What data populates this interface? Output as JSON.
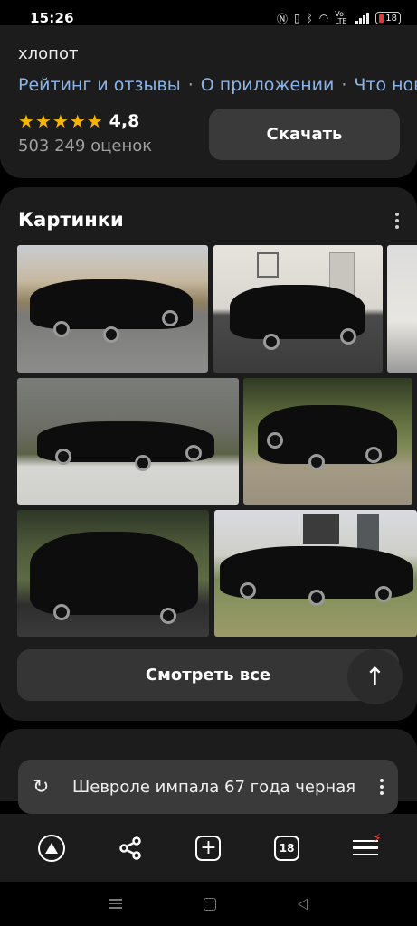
{
  "status_bar": {
    "time": "15:26",
    "battery": "18",
    "network": "Vo LTE"
  },
  "app_card": {
    "description_tail": "хлопот",
    "links": [
      "Рейтинг и отзывы",
      "О приложении",
      "Что ново"
    ],
    "rating_stars": "★★★★★",
    "rating": "4,8",
    "reviews": "503 249 оценок",
    "download_label": "Скачать"
  },
  "pictures": {
    "title": "Картинки",
    "see_all_label": "Смотреть все",
    "up_icon": "↑"
  },
  "search": {
    "query": "Шевроле импала 67 года черная",
    "refresh_icon": "↻"
  },
  "toolbar": {
    "tabs_count": "18",
    "plus_icon": "+",
    "share_icon": "share-icon",
    "alert_icon": "⚡"
  },
  "colors": {
    "background": "#000000",
    "card": "#1c1c1c",
    "link": "#8ab4e8",
    "star": "#f7b500",
    "button": "#3a3a3a"
  }
}
